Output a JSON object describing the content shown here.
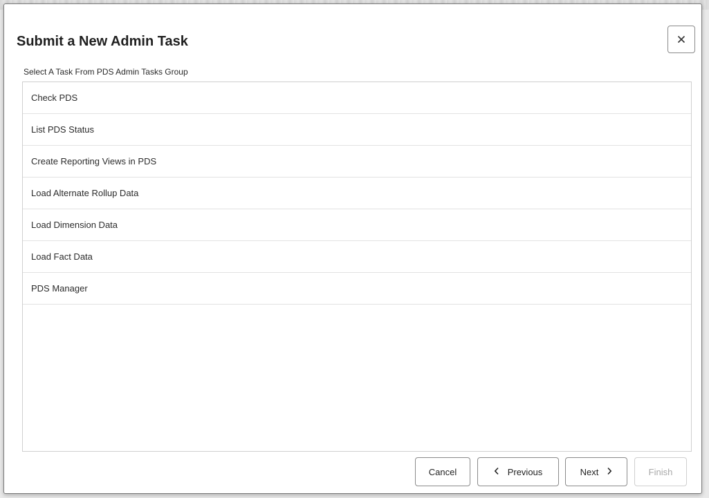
{
  "dialog": {
    "title": "Submit a New Admin Task",
    "close_icon": "close-icon",
    "subtitle": "Select A Task From PDS Admin Tasks Group"
  },
  "tasks": [
    {
      "label": "Check PDS"
    },
    {
      "label": "List PDS Status"
    },
    {
      "label": "Create Reporting Views in PDS"
    },
    {
      "label": "Load Alternate Rollup Data"
    },
    {
      "label": "Load Dimension Data"
    },
    {
      "label": "Load Fact Data"
    },
    {
      "label": "PDS Manager"
    }
  ],
  "footer": {
    "cancel_label": "Cancel",
    "previous_label": "Previous",
    "next_label": "Next",
    "finish_label": "Finish",
    "previous_icon": "chevron-left-icon",
    "next_icon": "chevron-right-icon"
  }
}
